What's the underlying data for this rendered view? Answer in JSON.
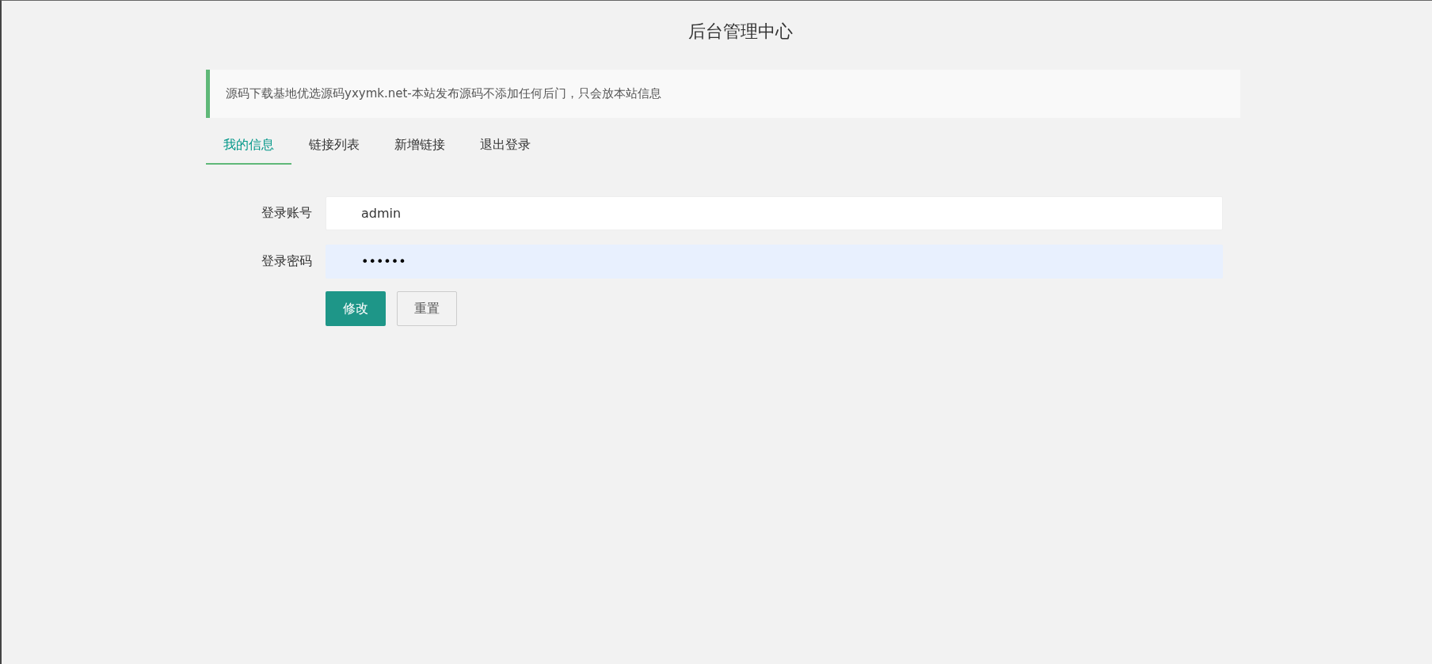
{
  "title": "后台管理中心",
  "notice": "源码下载基地优选源码yxymk.net-本站发布源码不添加任何后门，只会放本站信息",
  "tabs": [
    {
      "label": "我的信息",
      "selected": true
    },
    {
      "label": "链接列表",
      "selected": false
    },
    {
      "label": "新增链接",
      "selected": false
    },
    {
      "label": "退出登录",
      "selected": false
    }
  ],
  "fields": [
    {
      "label": "登录账号",
      "value": "admin",
      "kind": "text"
    },
    {
      "label": "登录密码",
      "value": "••••••",
      "kind": "password"
    }
  ],
  "buttons": [
    {
      "label": "修改",
      "kind": "primary"
    },
    {
      "label": "重置",
      "kind": "secondary"
    }
  ]
}
